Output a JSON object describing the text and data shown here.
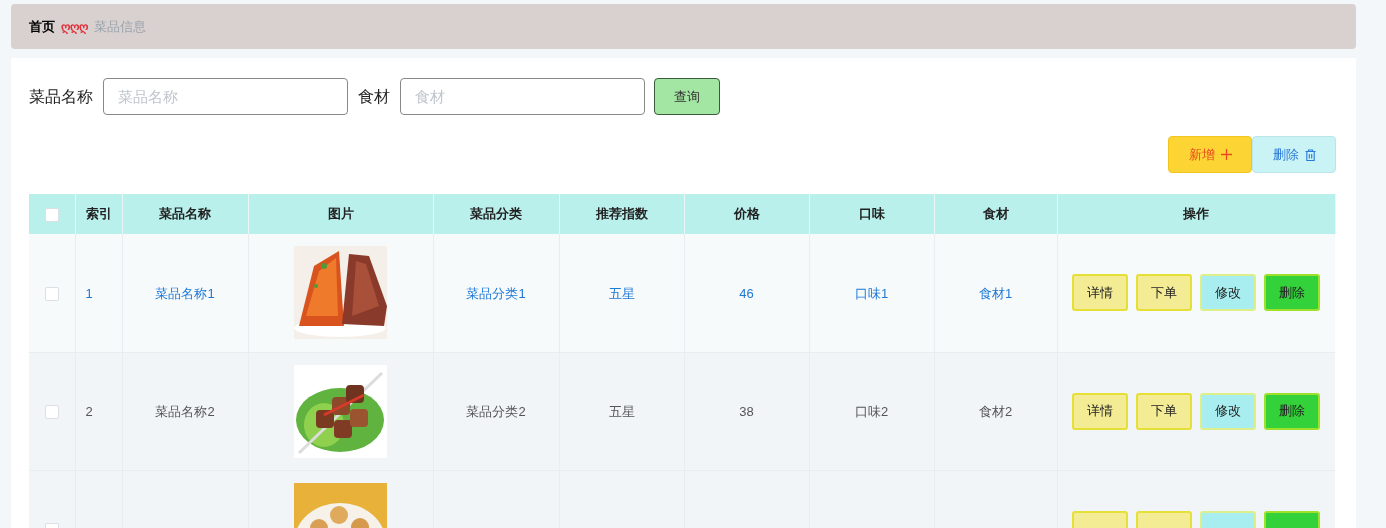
{
  "breadcrumb": {
    "home": "首页",
    "separator": "ღღღ",
    "current": "菜品信息"
  },
  "search": {
    "fields": [
      {
        "label": "菜品名称",
        "placeholder": "菜品名称"
      },
      {
        "label": "食材",
        "placeholder": "食材"
      }
    ],
    "button": "查询"
  },
  "actions": [
    {
      "kind": "add",
      "label": "新增"
    },
    {
      "kind": "delete",
      "label": "删除"
    }
  ],
  "table": {
    "select_all": {
      "checked": false
    },
    "columns": [
      "索引",
      "菜品名称",
      "图片",
      "菜品分类",
      "推荐指数",
      "价格",
      "口味",
      "食材",
      "操作"
    ],
    "rows": [
      {
        "checked": false,
        "highlighted": true,
        "index": "1",
        "name": "菜品名称1",
        "category": "菜品分类1",
        "rating": "五星",
        "price": "46",
        "flavor": "口味1",
        "ingredient": "食材1",
        "buttons": [
          {
            "kind": "details",
            "label": "详情"
          },
          {
            "kind": "order",
            "label": "下单"
          },
          {
            "kind": "edit",
            "label": "修改"
          },
          {
            "kind": "delete",
            "label": "删除"
          }
        ]
      },
      {
        "checked": false,
        "highlighted": false,
        "index": "2",
        "name": "菜品名称2",
        "category": "菜品分类2",
        "rating": "五星",
        "price": "38",
        "flavor": "口味2",
        "ingredient": "食材2",
        "buttons": [
          {
            "kind": "details",
            "label": "详情"
          },
          {
            "kind": "order",
            "label": "下单"
          },
          {
            "kind": "edit",
            "label": "修改"
          },
          {
            "kind": "delete",
            "label": "删除"
          }
        ]
      },
      {
        "checked": false,
        "buttons": [
          {
            "kind": "details"
          },
          {
            "kind": "order"
          },
          {
            "kind": "edit"
          },
          {
            "kind": "delete"
          }
        ]
      }
    ]
  }
}
